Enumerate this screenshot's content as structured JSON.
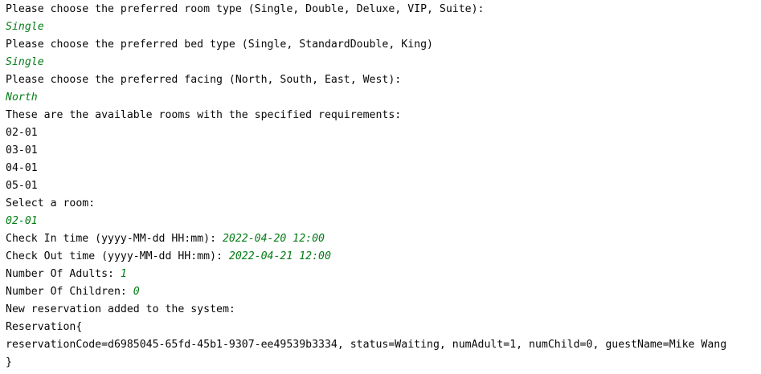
{
  "console": {
    "prompt_room_type": "Please choose the preferred room type (Single, Double, Deluxe, VIP, Suite):",
    "input_room_type": "Single",
    "prompt_bed_type": "Please choose the preferred bed type (Single, StandardDouble, King)",
    "input_bed_type": "Single",
    "prompt_facing": "Please choose the preferred facing (North, South, East, West):",
    "input_facing": "North",
    "available_header": "These are the available rooms with the specified requirements:",
    "rooms": [
      "02-01",
      "03-01",
      "04-01",
      "05-01"
    ],
    "prompt_select_room": "Select a room:",
    "input_room": "02-01",
    "prompt_check_in": "Check In time (yyyy-MM-dd HH:mm): ",
    "input_check_in": "2022-04-20 12:00",
    "prompt_check_out": "Check Out time (yyyy-MM-dd HH:mm): ",
    "input_check_out": "2022-04-21 12:00",
    "prompt_adults": "Number Of Adults: ",
    "input_adults": "1",
    "prompt_children": "Number Of Children: ",
    "input_children": "0",
    "added_message": "New reservation added to the system:",
    "reservation_open": "Reservation{",
    "reservation_body": "reservationCode=d6985045-65fd-45b1-9307-ee49539b3334, status=Waiting, numAdult=1, numChild=0, guestName=Mike Wang",
    "reservation_close": "}"
  },
  "colors": {
    "output_text": "#080808",
    "user_input": "#067d17",
    "background": "#ffffff"
  }
}
